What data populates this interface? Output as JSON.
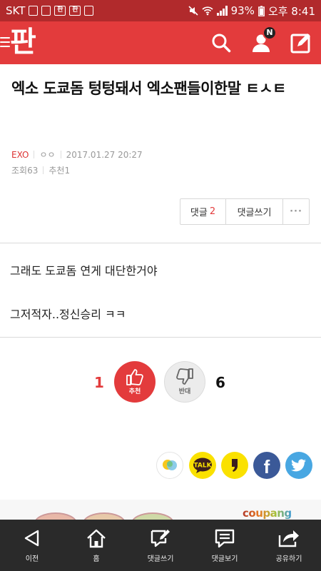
{
  "status_bar": {
    "carrier": "SKT",
    "notification_icons": [
      "message-icon",
      "image-icon",
      "pann-app-icon",
      "pann-app-icon",
      "clipboard-icon"
    ],
    "battery": "93%",
    "time": "오후 8:41"
  },
  "header": {
    "logo": "판",
    "notification_badge": "N",
    "brand_color": "#e33b3c"
  },
  "article": {
    "title": "엑소 도쿄돔 텅텅돼서 엑소팬들이한말 ㅌㅅㅌ",
    "category": "EXO",
    "author": "ㅇㅇ",
    "date": "2017.01.27 20:27",
    "views_label": "조회",
    "views": "63",
    "recommend_label": "추천",
    "recommend": "1",
    "body": [
      "그래도 도쿄돔 연게 대단한거야",
      "그저적자..정신승리 ㅋㅋ"
    ]
  },
  "actions": {
    "comment_label": "댓글",
    "comment_count": "2",
    "write_comment_label": "댓글쓰기",
    "more_label": "···"
  },
  "votes": {
    "up_count": "1",
    "up_label": "추천",
    "down_label": "반대",
    "down_count": "6"
  },
  "share": {
    "kakaotalk_label": "TALK",
    "facebook_label": "f"
  },
  "ad": {
    "brand": "coupang"
  },
  "bottom_nav": {
    "items": [
      {
        "label": "이전",
        "icon": "back-icon"
      },
      {
        "label": "홈",
        "icon": "home-icon"
      },
      {
        "label": "댓글쓰기",
        "icon": "write-comment-icon"
      },
      {
        "label": "댓글보기",
        "icon": "view-comments-icon"
      },
      {
        "label": "공유하기",
        "icon": "share-icon"
      }
    ]
  }
}
